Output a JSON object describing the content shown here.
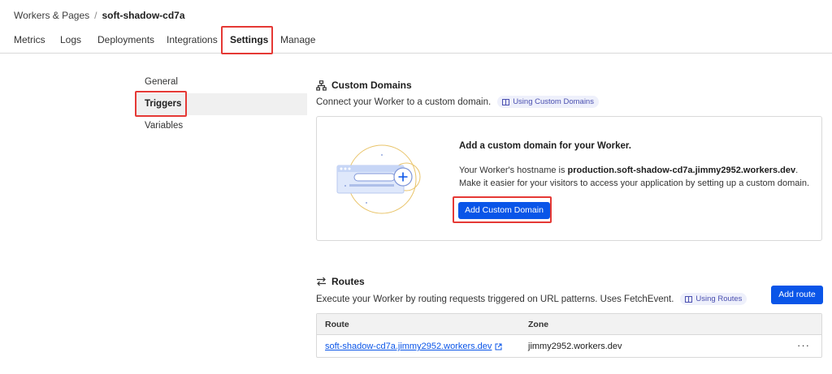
{
  "breadcrumb": {
    "parent": "Workers & Pages",
    "separator": "/",
    "current": "soft-shadow-cd7a"
  },
  "tabs": [
    {
      "label": "Metrics"
    },
    {
      "label": "Logs"
    },
    {
      "label": "Deployments"
    },
    {
      "label": "Integrations"
    },
    {
      "label": "Settings",
      "active": true
    },
    {
      "label": "Manage"
    }
  ],
  "sidebar": {
    "items": [
      {
        "label": "General"
      },
      {
        "label": "Triggers",
        "active": true
      },
      {
        "label": "Variables"
      }
    ]
  },
  "custom_domains": {
    "title": "Custom Domains",
    "description": "Connect your Worker to a custom domain.",
    "doc_badge": "Using Custom Domains",
    "card": {
      "heading": "Add a custom domain for your Worker.",
      "hostname_prefix": "Your Worker's hostname is ",
      "hostname": "production.soft-shadow-cd7a.jimmy2952.workers.dev",
      "hostname_suffix": ".",
      "line2": "Make it easier for your visitors to access your application by setting up a custom domain.",
      "button": "Add Custom Domain"
    }
  },
  "routes": {
    "title": "Routes",
    "description": "Execute your Worker by routing requests triggered on URL patterns. Uses FetchEvent.",
    "doc_badge": "Using Routes",
    "add_button": "Add route",
    "table": {
      "columns": [
        "Route",
        "Zone"
      ],
      "rows": [
        {
          "route": "soft-shadow-cd7a.jimmy2952.workers.dev",
          "zone": "jimmy2952.workers.dev",
          "menu": "···"
        }
      ]
    }
  },
  "colors": {
    "accent": "#0a55e8",
    "highlight": "#e53935",
    "badge_bg": "#eef0fb",
    "badge_text": "#4a4fb0"
  }
}
